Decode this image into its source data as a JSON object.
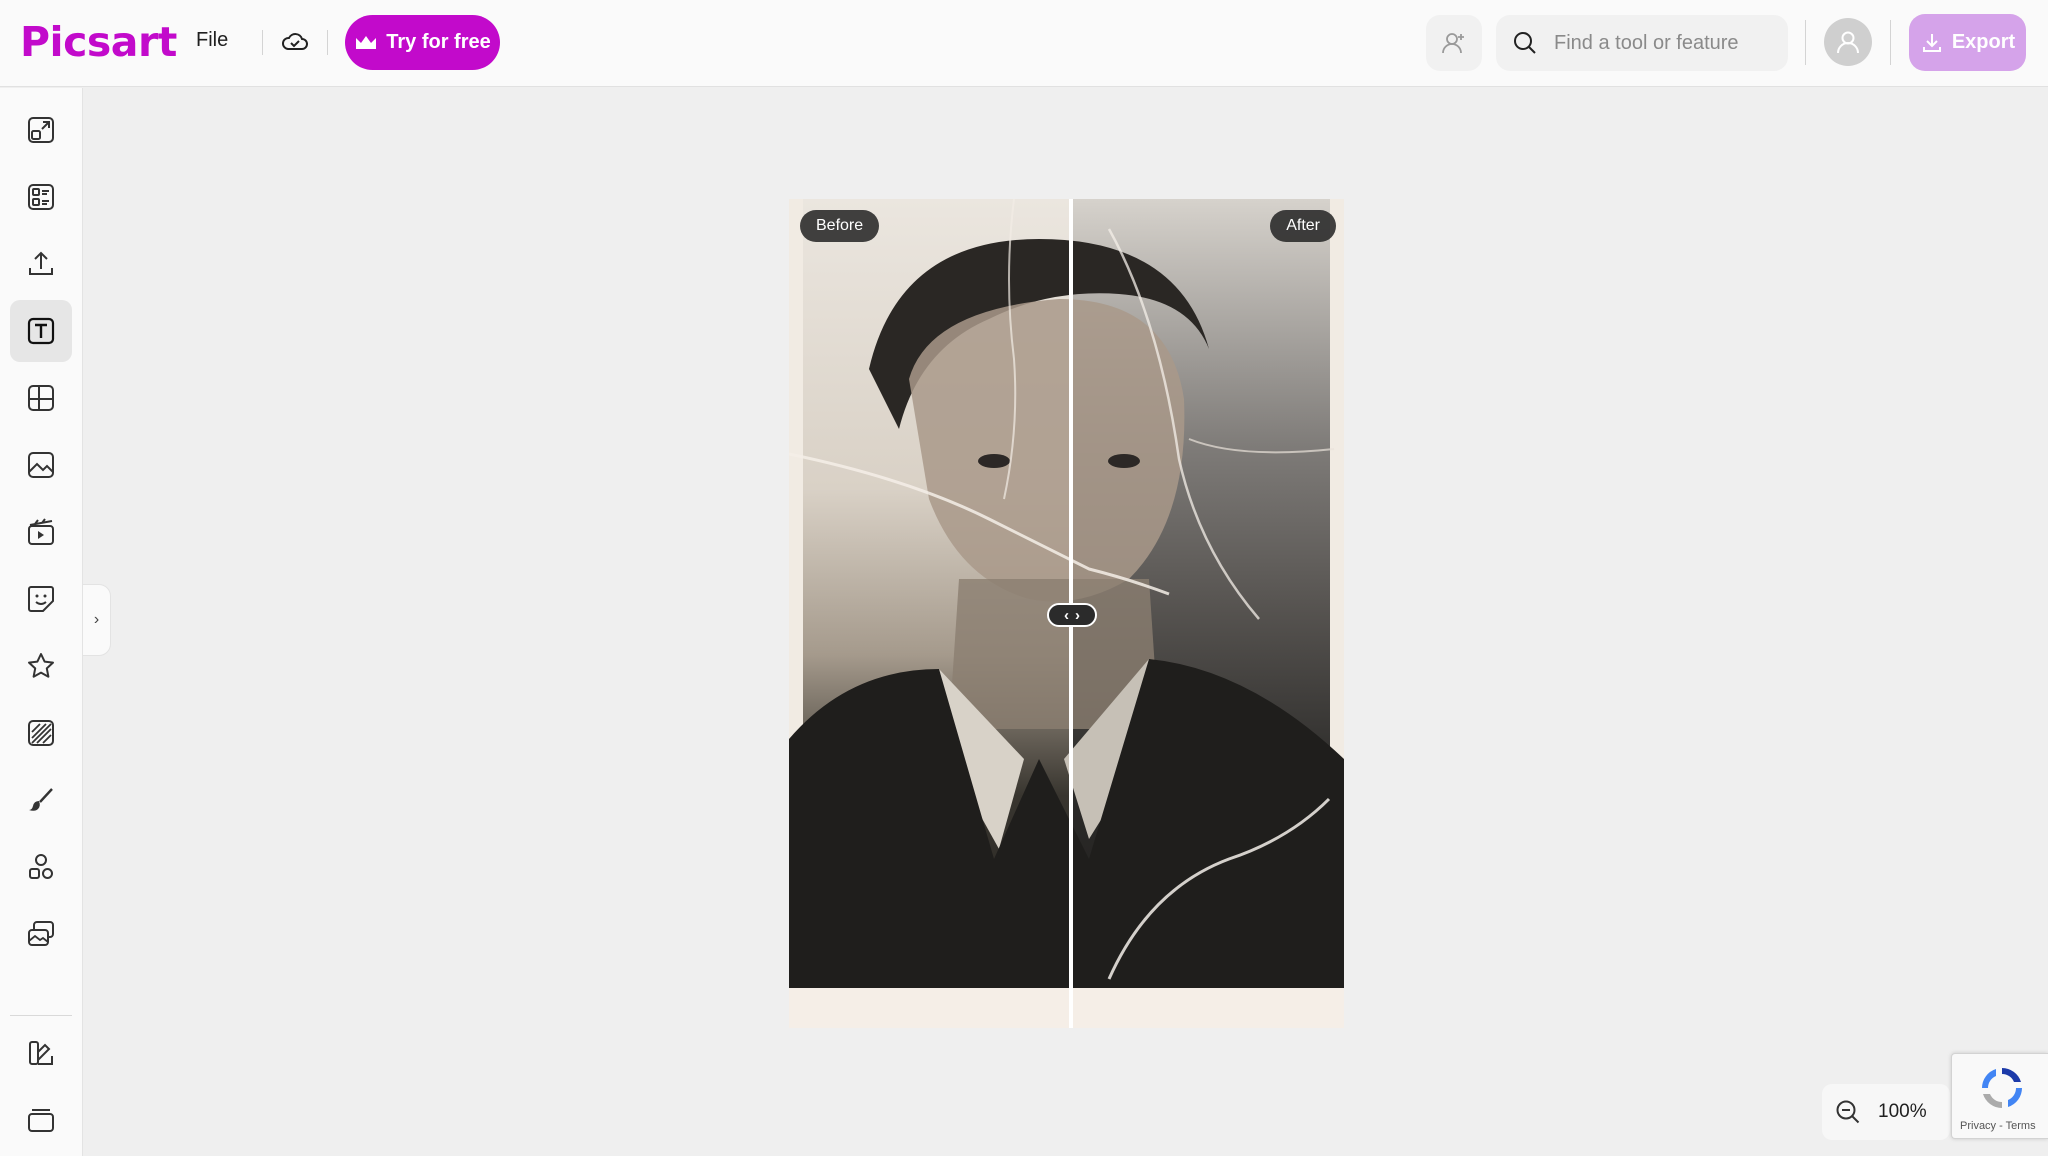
{
  "app": {
    "logo_text": "Picsart",
    "brand_color": "#c20acb"
  },
  "topbar": {
    "file_label": "File",
    "cloud_icon": "cloud-check-icon",
    "try_label": "Try for free",
    "try_icon": "crown-icon",
    "invite_icon": "add-user-icon",
    "search_placeholder": "Find a tool or feature",
    "search_icon": "search-icon",
    "avatar_icon": "user-icon",
    "export_label": "Export",
    "export_icon": "download-icon"
  },
  "sidebar": {
    "items": [
      {
        "icon": "resize-icon",
        "active": false
      },
      {
        "icon": "templates-icon",
        "active": false
      },
      {
        "icon": "upload-icon",
        "active": false
      },
      {
        "icon": "text-icon",
        "active": true
      },
      {
        "icon": "layout-icon",
        "active": false
      },
      {
        "icon": "photos-icon",
        "active": false
      },
      {
        "icon": "video-icon",
        "active": false
      },
      {
        "icon": "stickers-icon",
        "active": false
      },
      {
        "icon": "star-icon",
        "active": false
      },
      {
        "icon": "backgrounds-icon",
        "active": false
      },
      {
        "icon": "brush-icon",
        "active": false
      },
      {
        "icon": "elements-icon",
        "active": false
      },
      {
        "icon": "my-files-icon",
        "active": false
      },
      {
        "icon": "brand-kit-icon",
        "active": false
      },
      {
        "icon": "folders-icon",
        "active": false
      }
    ],
    "collapse_icon": "chevron-right-icon"
  },
  "canvas": {
    "before_label": "Before",
    "after_label": "After",
    "handle_left": "‹",
    "handle_right": "›"
  },
  "zoom": {
    "value": "100%",
    "icon": "zoom-out-icon"
  },
  "recaptcha": {
    "text": "Privacy - Terms",
    "icon": "recaptcha-icon"
  }
}
